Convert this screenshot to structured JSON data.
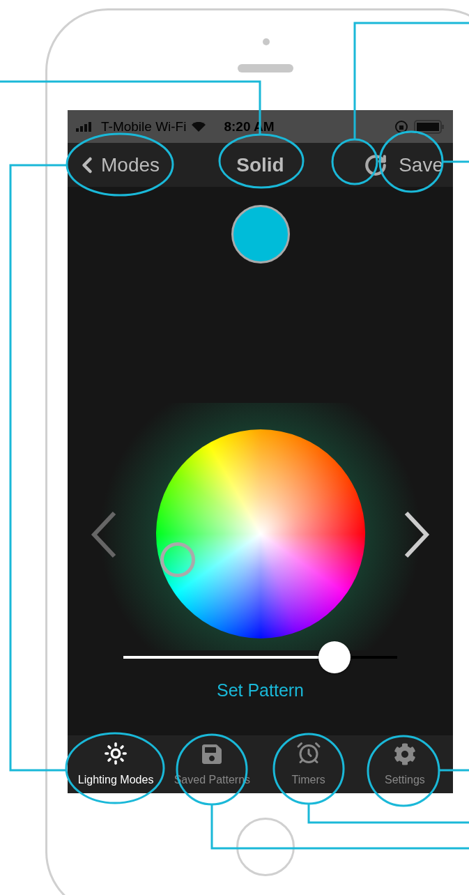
{
  "status_bar": {
    "carrier": "T-Mobile Wi-Fi",
    "time": "8:20 AM"
  },
  "nav_bar": {
    "back_label": "Modes",
    "title": "Solid",
    "action": "Save"
  },
  "swatch": {
    "color": "#00bcd9"
  },
  "brightness": {
    "level": 0.77
  },
  "set_button": "Set Pattern",
  "tabs": [
    {
      "label": "Lighting Modes",
      "kind": "sun",
      "selected": true
    },
    {
      "label": "Saved Patterns",
      "kind": "disk",
      "selected": false
    },
    {
      "label": "Timers",
      "kind": "alarm",
      "selected": false
    },
    {
      "label": "Settings",
      "kind": "gear",
      "selected": false
    }
  ]
}
